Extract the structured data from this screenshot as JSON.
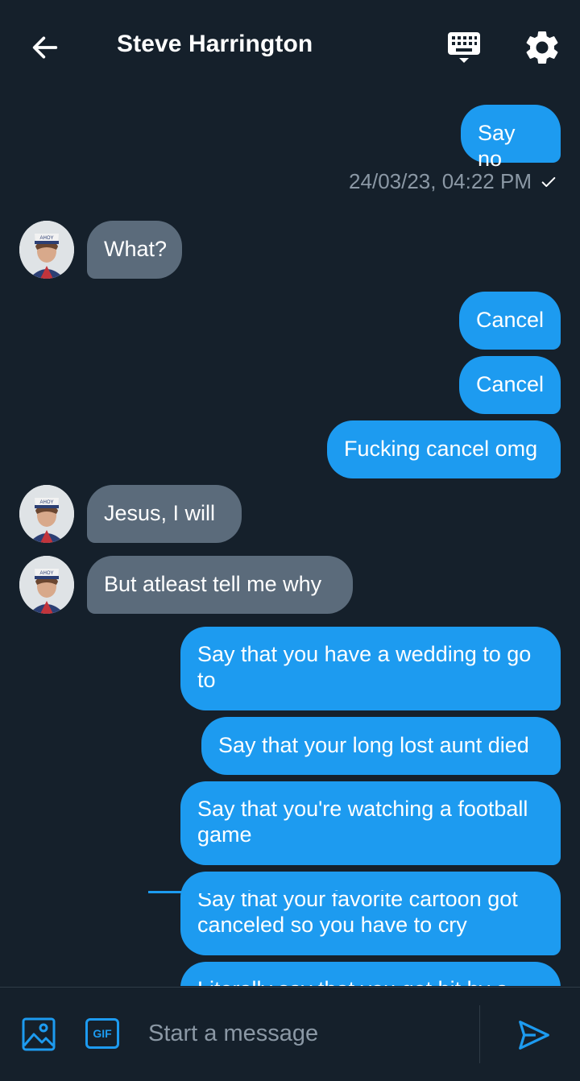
{
  "header": {
    "title": "Steve Harrington"
  },
  "thread": {
    "timestamp": "24/03/23, 04:22 PM",
    "messages": [
      {
        "text": "Say no"
      },
      {
        "text": "What?"
      },
      {
        "text": "Cancel"
      },
      {
        "text": "Cancel"
      },
      {
        "text": "Fucking cancel omg"
      },
      {
        "text": "Jesus, I will"
      },
      {
        "text": "But atleast tell me why"
      },
      {
        "text": "Say that you have a wedding to go to"
      },
      {
        "text": "Say that your long lost aunt died"
      },
      {
        "text": "Say that you're watching a football game"
      },
      {
        "text": "Say that your favorite cartoon got canceled so you have to cry"
      },
      {
        "text": "Literally say that you got bit by a"
      }
    ]
  },
  "composer": {
    "placeholder": "Start a message",
    "gif_label": "GIF"
  },
  "colors": {
    "background": "#15202b",
    "outgoing_bubble": "#1d9bf0",
    "incoming_bubble": "#5b6b7b",
    "muted_text": "#8b98a5"
  }
}
